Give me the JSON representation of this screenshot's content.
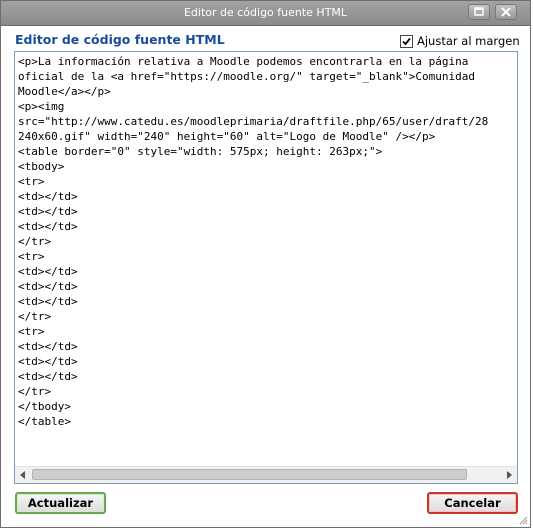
{
  "window": {
    "title": "Editor de código fuente HTML"
  },
  "dialog": {
    "heading": "Editor de código fuente HTML",
    "wrap_label": "Ajustar al margen",
    "wrap_checked": true
  },
  "editor": {
    "lines": [
      "<p>La información relativa a Moodle podemos encontrarla en la página",
      "oficial de la <a href=\"https://moodle.org/\" target=\"_blank\">Comunidad",
      "Moodle</a></p>",
      "<p><img",
      "src=\"http://www.catedu.es/moodleprimaria/draftfile.php/65/user/draft/28",
      "240x60.gif\" width=\"240\" height=\"60\" alt=\"Logo de Moodle\" /></p>",
      "<table border=\"0\" style=\"width: 575px; height: 263px;\">",
      "<tbody>",
      "<tr>",
      "<td></td>",
      "<td></td>",
      "<td></td>",
      "</tr>",
      "<tr>",
      "<td></td>",
      "<td></td>",
      "<td></td>",
      "</tr>",
      "<tr>",
      "<td></td>",
      "<td></td>",
      "<td></td>",
      "</tr>",
      "</tbody>",
      "</table>"
    ],
    "scroll_fraction_visible": 0.93
  },
  "buttons": {
    "update_label": "Actualizar",
    "cancel_label": "Cancelar"
  },
  "colors": {
    "heading": "#1a4e9a",
    "update_border": "#6aa84f",
    "cancel_border": "#c0392b"
  },
  "icons": {
    "maximize": "maximize-icon",
    "close": "close-icon",
    "check": "check-icon",
    "scroll_left": "arrow-left-icon",
    "scroll_right": "arrow-right-icon",
    "resize": "resize-grip-icon"
  }
}
